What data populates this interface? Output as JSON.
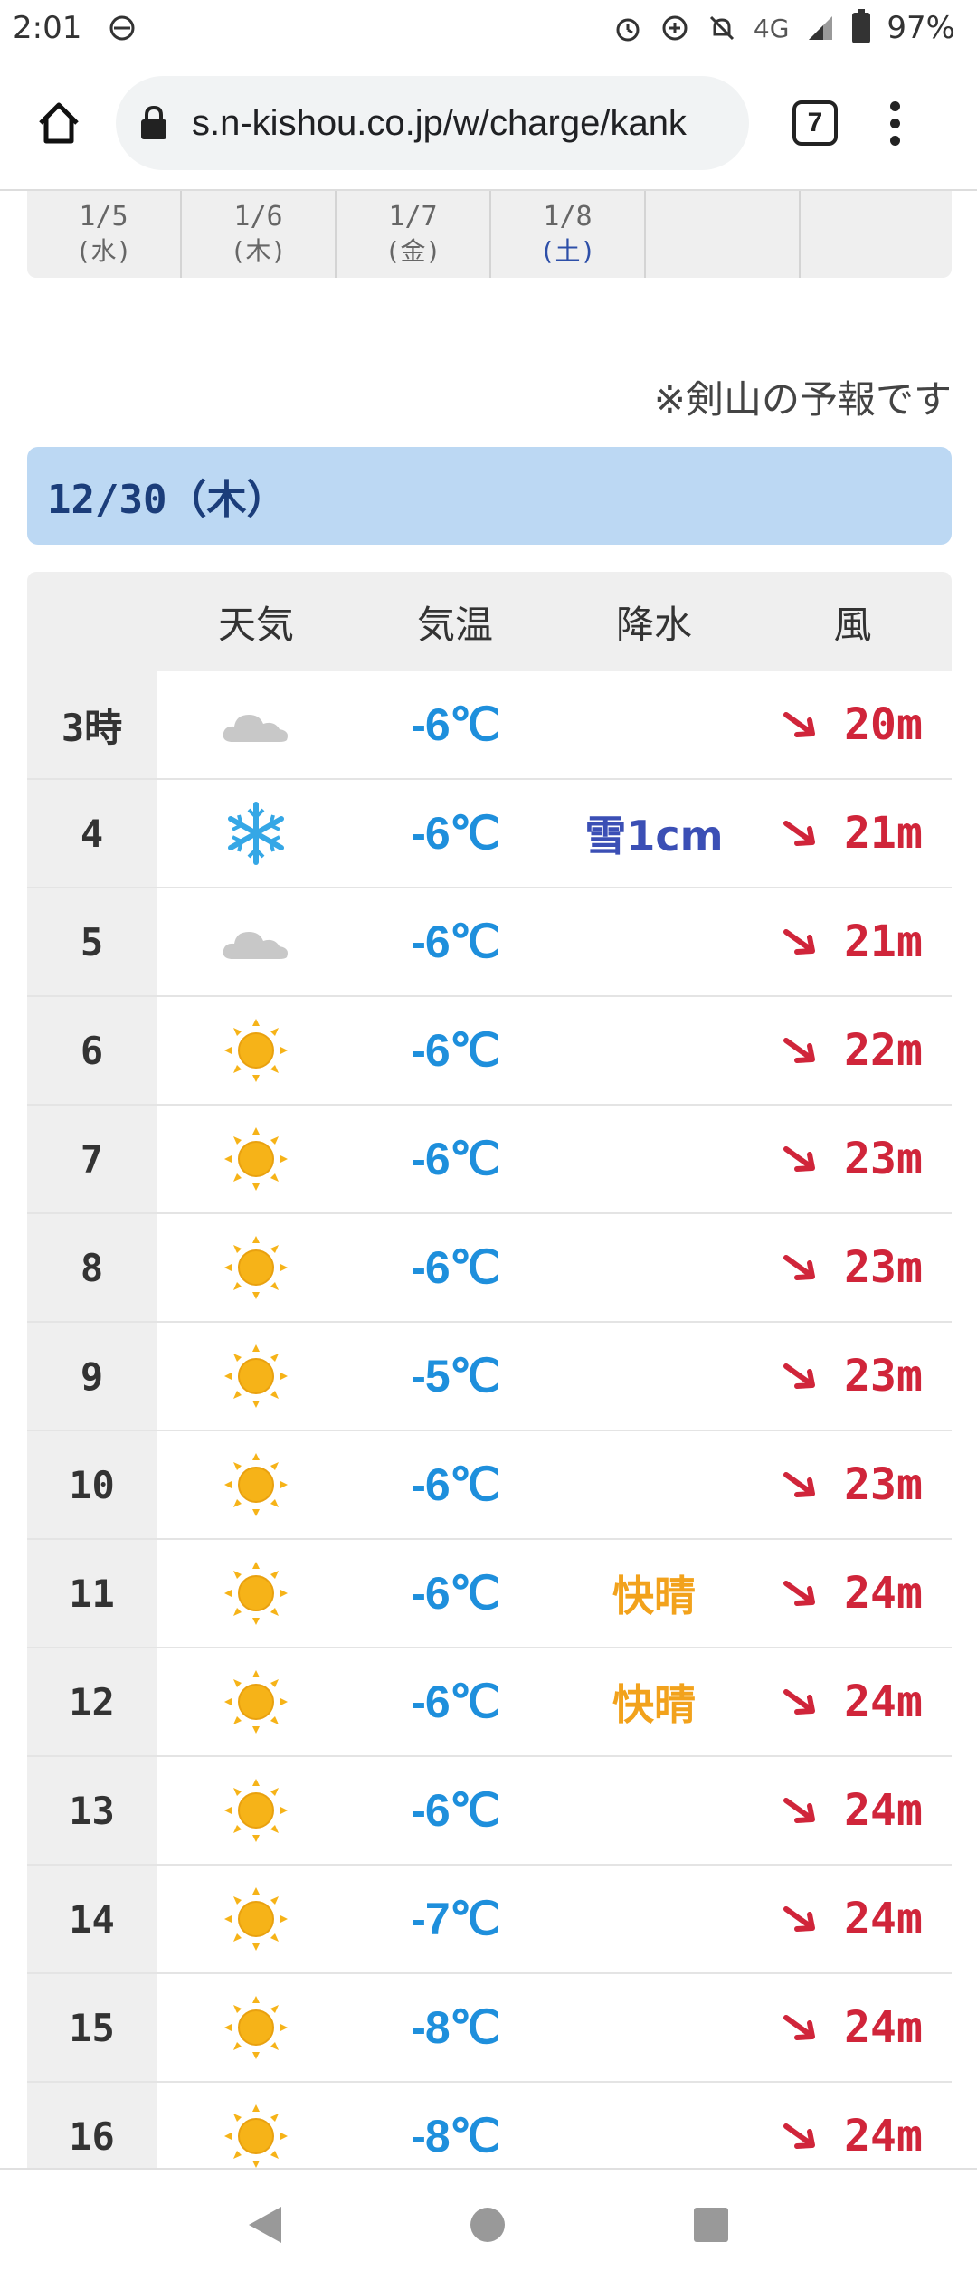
{
  "status_bar": {
    "time": "2:01",
    "network": "4G",
    "battery": "97%",
    "icons": [
      "data-saver-icon",
      "alarm-icon",
      "data-saver-plus-icon",
      "bell-off-icon",
      "signal-icon",
      "battery-icon"
    ]
  },
  "browser": {
    "url": "s.n-kishou.co.jp/w/charge/kank",
    "tab_count": "7"
  },
  "date_tabs": [
    {
      "date": "1/5",
      "dow": "(水)"
    },
    {
      "date": "1/6",
      "dow": "(木)"
    },
    {
      "date": "1/7",
      "dow": "(金)"
    },
    {
      "date": "1/8",
      "dow": "(土)"
    },
    {
      "date": "",
      "dow": ""
    }
  ],
  "note": "※剣山の予報です",
  "day_header": "12/30（木）",
  "table": {
    "headers": [
      "",
      "天気",
      "気温",
      "降水",
      "風"
    ],
    "rows": [
      {
        "hour": "3時",
        "weather": "cloudy",
        "temp": "-6℃",
        "precip": "",
        "wind": "20m"
      },
      {
        "hour": "4",
        "weather": "snow",
        "temp": "-6℃",
        "precip": "雪1cm",
        "wind": "21m"
      },
      {
        "hour": "5",
        "weather": "cloudy",
        "temp": "-6℃",
        "precip": "",
        "wind": "21m"
      },
      {
        "hour": "6",
        "weather": "sunny",
        "temp": "-6℃",
        "precip": "",
        "wind": "22m"
      },
      {
        "hour": "7",
        "weather": "sunny",
        "temp": "-6℃",
        "precip": "",
        "wind": "23m"
      },
      {
        "hour": "8",
        "weather": "sunny",
        "temp": "-6℃",
        "precip": "",
        "wind": "23m"
      },
      {
        "hour": "9",
        "weather": "sunny",
        "temp": "-5℃",
        "precip": "",
        "wind": "23m"
      },
      {
        "hour": "10",
        "weather": "sunny",
        "temp": "-6℃",
        "precip": "",
        "wind": "23m"
      },
      {
        "hour": "11",
        "weather": "sunny",
        "temp": "-6℃",
        "precip": "快晴",
        "wind": "24m"
      },
      {
        "hour": "12",
        "weather": "sunny",
        "temp": "-6℃",
        "precip": "快晴",
        "wind": "24m"
      },
      {
        "hour": "13",
        "weather": "sunny",
        "temp": "-6℃",
        "precip": "",
        "wind": "24m"
      },
      {
        "hour": "14",
        "weather": "sunny",
        "temp": "-7℃",
        "precip": "",
        "wind": "24m"
      },
      {
        "hour": "15",
        "weather": "sunny",
        "temp": "-8℃",
        "precip": "",
        "wind": "24m"
      },
      {
        "hour": "16",
        "weather": "sunny",
        "temp": "-8℃",
        "precip": "",
        "wind": "24m"
      }
    ]
  },
  "colors": {
    "temp": "#1e8fdc",
    "wind": "#d0253a",
    "snow_text": "#3b4fb5",
    "clear_text": "#f2a21c",
    "day_bar": "#bcd8f3"
  }
}
